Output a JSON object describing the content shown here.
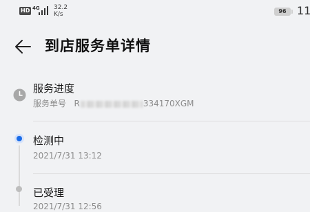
{
  "status_bar": {
    "hd": "HD",
    "network": "4G",
    "speed_value": "32.2",
    "speed_unit": "K/s",
    "battery": "96",
    "time": "11"
  },
  "header": {
    "back_icon": "back-arrow-icon",
    "title": "到店服务单详情"
  },
  "progress": {
    "icon": "clock-icon",
    "title": "服务进度",
    "order_label": "服务单号",
    "order_prefix": "R",
    "order_suffix": "334170XGM"
  },
  "timeline": [
    {
      "status": "检测中",
      "time": "2021/7/31 13:12",
      "active": true
    },
    {
      "status": "已受理",
      "time": "2021/7/31 12:56",
      "active": false
    }
  ],
  "colors": {
    "active": "#1a6ce8",
    "inactive": "#bdbdbd",
    "background": "#f1f2f4"
  }
}
